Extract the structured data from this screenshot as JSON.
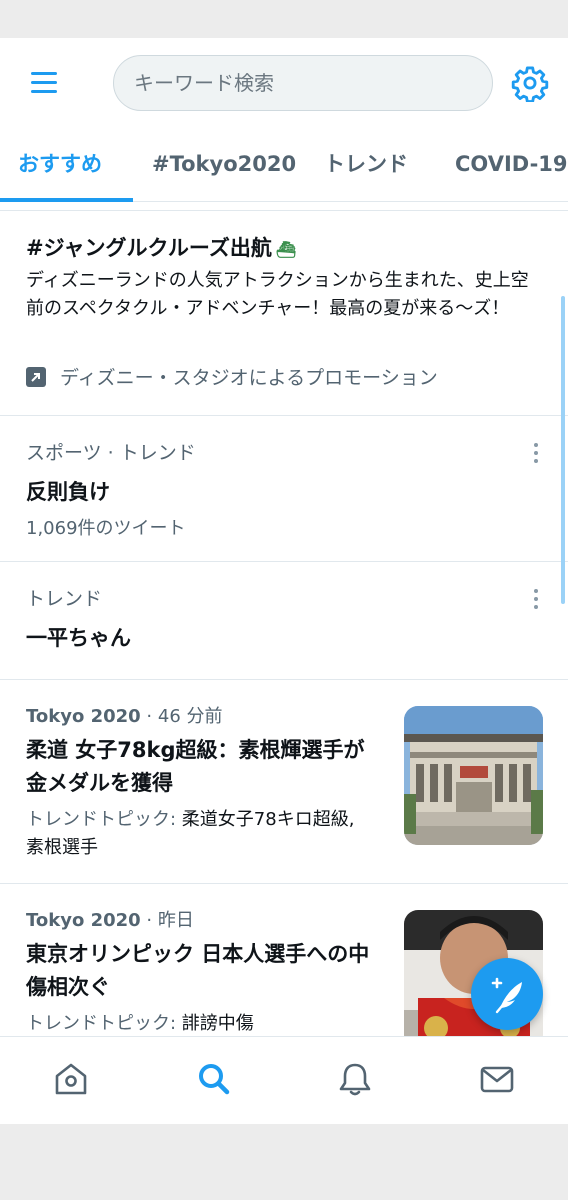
{
  "header": {
    "search_placeholder": "キーワード検索"
  },
  "tabs": [
    {
      "label": "おすすめ",
      "active": true
    },
    {
      "label": "#Tokyo2020",
      "active": false
    },
    {
      "label": "トレンド",
      "active": false
    },
    {
      "label": "COVID-19",
      "active": false
    }
  ],
  "promo": {
    "title": "#ジャングルクルーズ出航",
    "body": "ディズニーランドの人気アトラクションから生まれた、史上空前のスペクタクル・アドベンチャー！最高の夏が来る〜ズ！",
    "promoted_by": "ディズニー・スタジオによるプロモーション"
  },
  "trends": [
    {
      "category": "スポーツ · トレンド",
      "name": "反則負け",
      "count": "1,069件のツイート"
    },
    {
      "category": "トレンド",
      "name": "一平ちゃん",
      "count": ""
    }
  ],
  "news": [
    {
      "source": "Tokyo 2020",
      "time": " · 46 分前",
      "title": "柔道 女子78kg超級：素根輝選手が金メダルを獲得",
      "topic_label": "トレンドトピック: ",
      "topics": "柔道女子78キロ超級, 素根選手"
    },
    {
      "source": "Tokyo 2020",
      "time": " · 昨日",
      "title": "東京オリンピック 日本人選手への中傷相次ぐ",
      "topic_label": "トレンドトピック: ",
      "topics": "誹謗中傷"
    }
  ],
  "colors": {
    "accent": "#1d9bf0",
    "secondary_text": "#536471",
    "divider": "#e1e8ed"
  },
  "icons": {
    "menu": "hamburger-menu-icon",
    "settings": "gear-icon",
    "promoted": "promoted-arrow-icon",
    "more": "more-vertical-icon",
    "compose": "compose-tweet-icon",
    "home": "home-icon",
    "explore": "search-icon",
    "notifications": "bell-icon",
    "messages": "envelope-icon"
  }
}
